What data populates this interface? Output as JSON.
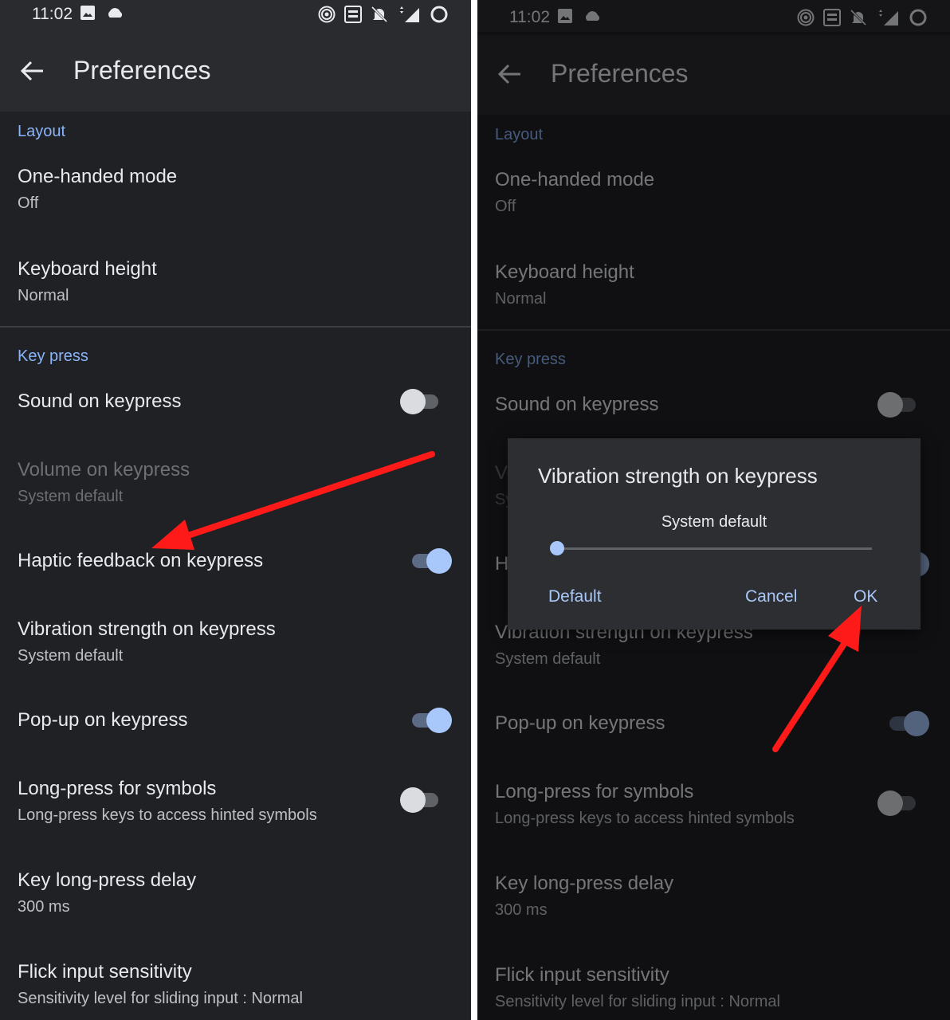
{
  "status_bar": {
    "time": "11:02"
  },
  "app_bar": {
    "title": "Preferences"
  },
  "sections": {
    "layout": "Layout",
    "key_press": "Key press"
  },
  "settings": {
    "one_handed": {
      "title": "One-handed mode",
      "value": "Off"
    },
    "keyboard_height": {
      "title": "Keyboard height",
      "value": "Normal"
    },
    "sound": {
      "title": "Sound on keypress",
      "enabled": false
    },
    "volume": {
      "title": "Volume on keypress",
      "value": "System default"
    },
    "haptic": {
      "title": "Haptic feedback on keypress",
      "enabled": true
    },
    "vibration": {
      "title": "Vibration strength on keypress",
      "value": "System default"
    },
    "popup": {
      "title": "Pop-up on keypress",
      "enabled": true
    },
    "long_press": {
      "title": "Long-press for symbols",
      "value": "Long-press keys to access hinted symbols",
      "enabled": false
    },
    "delay": {
      "title": "Key long-press delay",
      "value": "300 ms"
    },
    "flick": {
      "title": "Flick input sensitivity",
      "value": "Sensitivity level for sliding input : Normal"
    }
  },
  "dialog": {
    "title": "Vibration strength on keypress",
    "value_label": "System default",
    "slider_level": 0,
    "buttons": {
      "default": "Default",
      "cancel": "Cancel",
      "ok": "OK"
    }
  },
  "colors": {
    "accent": "#8ab4f8",
    "annotation_arrow": "#ff1a1a",
    "background": "#202124"
  }
}
